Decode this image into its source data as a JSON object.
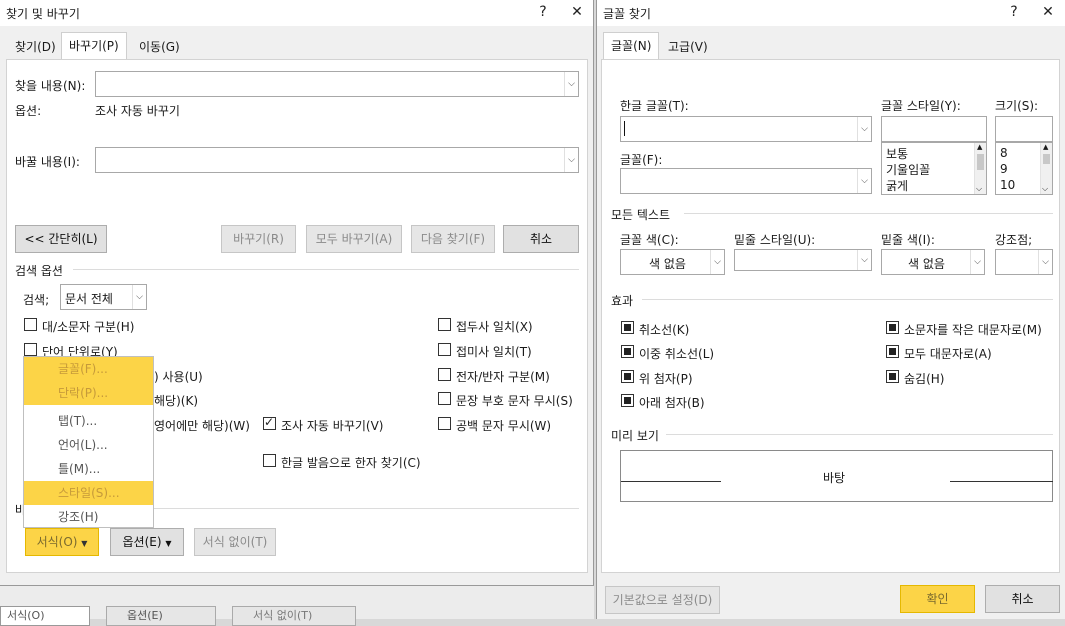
{
  "find_replace": {
    "title": "찾기 및 바꾸기",
    "help": "?",
    "close": "✕",
    "tabs": [
      "찾기(D)",
      "바꾸기(P)",
      "이동(G)"
    ],
    "find_label": "찾을 내용(N):",
    "options_label": "옵션:",
    "options_value": "조사 자동 바꾸기",
    "replace_label": "바꿀 내용(I):",
    "buttons": {
      "less": "<< 간단히(L)",
      "replace": "바꾸기(R)",
      "replace_all": "모두 바꾸기(A)",
      "find_next": "다음 찾기(F)",
      "cancel": "취소"
    },
    "search_options_title": "검색 옵션",
    "search_label": "검색;",
    "search_value": "문서 전체",
    "left_checks": [
      "대/소문자 구분(H)",
      "단어 단위로(Y)"
    ],
    "left_partial": [
      ") 사용(U)",
      "해당)(K)",
      "영어에만 해당)(W)"
    ],
    "auto_josa": "조사 자동 바꾸기(V)",
    "hanja": "한글 발음으로 한자 찾기(C)",
    "right_checks": [
      "접두사 일치(X)",
      "접미사 일치(T)",
      "전자/반자 구분(M)",
      "문장 부호 문자 무시(S)",
      "공백 문자 무시(W)"
    ],
    "replace_section_partial": "바",
    "format_menu": [
      "글꼴(F)...",
      "단락(P)...",
      "탭(T)...",
      "언어(L)...",
      "틀(M)...",
      "스타일(S)...",
      "강조(H)"
    ],
    "bottom_buttons": {
      "format": "서식(O)",
      "special": "옵션(E)",
      "no_format": "서식 없이(T)"
    },
    "bg_strip": [
      "서식(O)",
      "옵션(E)",
      "서식 없이(T)"
    ]
  },
  "find_font": {
    "title": "글꼴 찾기",
    "help": "?",
    "close": "✕",
    "tabs": [
      "글꼴(N)",
      "고급(V)"
    ],
    "hangul_font_label": "한글 글꼴(T):",
    "font_label": "글꼴(F):",
    "style_label": "글꼴 스타일(Y):",
    "size_label": "크기(S):",
    "styles": [
      "보통",
      "기울임꼴",
      "굵게"
    ],
    "sizes": [
      "8",
      "9",
      "10"
    ],
    "all_text_title": "모든 텍스트",
    "font_color_label": "글꼴 색(C):",
    "font_color_value": "색 없음",
    "underline_style_label": "밑줄 스타일(U):",
    "underline_color_label": "밑줄 색(I):",
    "underline_color_value": "색 없음",
    "emphasis_label": "강조점;",
    "effects_title": "효과",
    "effects_left": [
      "취소선(K)",
      "이중 취소선(L)",
      "위 첨자(P)",
      "아래 첨자(B)"
    ],
    "effects_right": [
      "소문자를 작은 대문자로(M)",
      "모두 대문자로(A)",
      "숨김(H)"
    ],
    "preview_title": "미리 보기",
    "preview_text": "바탕",
    "buttons": {
      "default": "기본값으로 설정(D)",
      "ok": "확인",
      "cancel": "취소"
    }
  },
  "accent_color": "#fcd447"
}
